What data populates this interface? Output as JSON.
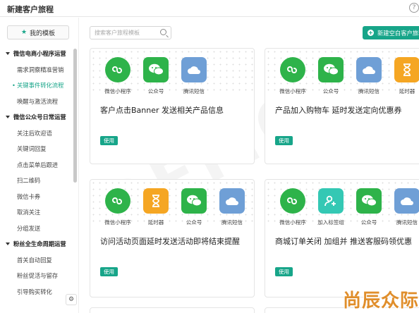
{
  "header": {
    "title": "新建客户旅程",
    "help_icon": "?"
  },
  "sidebar": {
    "my_templates": "我的模板",
    "groups": [
      {
        "label": "微信电商小程序运营",
        "items": [
          "需求洞察精准营销",
          "关键事件转化流程",
          "唤醒与激活流程"
        ],
        "active_index": 1
      },
      {
        "label": "微信公众号日常运营",
        "items": [
          "关注后欢迎语",
          "关键词回复",
          "点击菜单后跟进",
          "扫二维码",
          "微信卡券",
          "取消关注",
          "分组发送"
        ]
      },
      {
        "label": "粉丝全生命周期运营",
        "items": [
          "首关自动回复",
          "粉丝促活与留存",
          "引导购买转化"
        ]
      }
    ]
  },
  "toolbar": {
    "search_placeholder": "搜索客户旅程模板",
    "new_button": "新建空白客户旅程"
  },
  "cards": [
    {
      "title": "客户点击Banner 发送相关产品信息",
      "tag": "使用",
      "icons": [
        {
          "name": "miniprogram-icon",
          "label": "微信小程序",
          "color": "green"
        },
        {
          "name": "wechat-icon",
          "label": "公众号",
          "color": "wechat"
        },
        {
          "name": "cloud-sms-icon",
          "label": "腾讯短信",
          "color": "blue"
        }
      ]
    },
    {
      "title": "产品加入购物车 延时发送定向优惠券",
      "tag": "使用",
      "icons": [
        {
          "name": "miniprogram-icon",
          "label": "微信小程序",
          "color": "green"
        },
        {
          "name": "wechat-icon",
          "label": "公众号",
          "color": "wechat"
        },
        {
          "name": "cloud-sms-icon",
          "label": "腾讯短信",
          "color": "blue"
        },
        {
          "name": "hourglass-icon",
          "label": "延时器",
          "color": "orange"
        }
      ]
    },
    {
      "title": "访问活动页面延时发送活动即将结束提醒",
      "tag": "使用",
      "icons": [
        {
          "name": "miniprogram-icon",
          "label": "微信小程序",
          "color": "green"
        },
        {
          "name": "hourglass-icon",
          "label": "延时器",
          "color": "orange"
        },
        {
          "name": "wechat-icon",
          "label": "公众号",
          "color": "wechat"
        },
        {
          "name": "cloud-sms-icon",
          "label": "腾讯短信",
          "color": "blue"
        }
      ]
    },
    {
      "title": "商城订单关闭 加组并 推送客服码领优惠",
      "tag": "使用",
      "icons": [
        {
          "name": "miniprogram-icon",
          "label": "微信小程序",
          "color": "green"
        },
        {
          "name": "add-tag-icon",
          "label": "加入标签组",
          "color": "teal"
        },
        {
          "name": "wechat-icon",
          "label": "公众号",
          "color": "wechat"
        },
        {
          "name": "cloud-sms-icon",
          "label": "腾讯短信",
          "color": "blue"
        }
      ]
    }
  ],
  "watermark": "DEMO",
  "brand_watermark": "尚辰众际",
  "colors": {
    "accent": "#17a589",
    "green": "#2eb34a",
    "blue": "#6f9fd6",
    "orange": "#f5a623",
    "teal": "#34c8b4"
  }
}
